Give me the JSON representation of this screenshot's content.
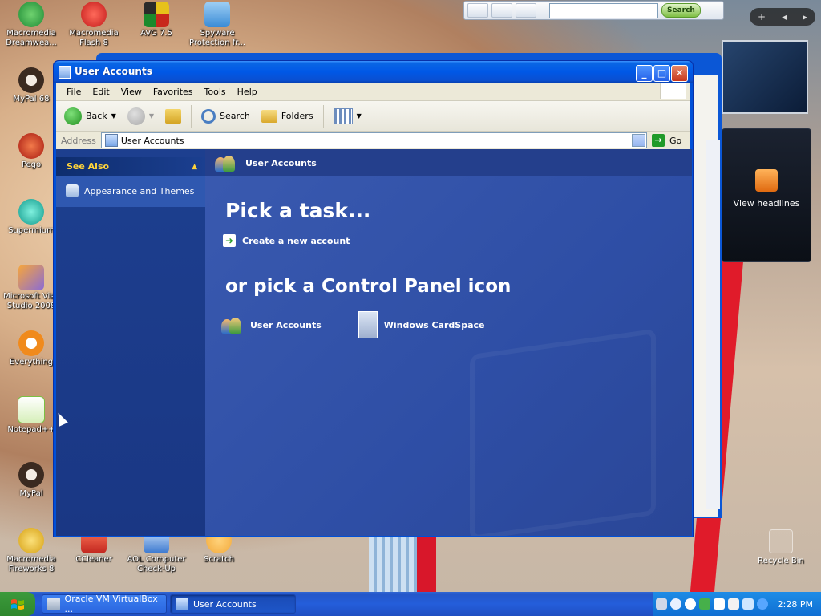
{
  "desktop": {
    "icons": [
      {
        "label": "Macromedia Dreamwea...",
        "icon": "dreamweaver-icon",
        "color": "#2aa84a"
      },
      {
        "label": "Macromedia Flash 8",
        "icon": "flash-icon",
        "color": "#d32222"
      },
      {
        "label": "AVG 7.5",
        "icon": "avg-icon",
        "color": "#e7c21a"
      },
      {
        "label": "Spyware Protection fr...",
        "icon": "spyware-icon",
        "color": "#4aa0e0"
      },
      {
        "label": "MyPal 68",
        "icon": "mypal-icon",
        "color": "#3b2a20"
      },
      {
        "label": "Pego",
        "icon": "pego-icon",
        "color": "#c2261f"
      },
      {
        "label": "Supermium",
        "icon": "supermium-icon",
        "color": "#1bb5a5"
      },
      {
        "label": "Microsoft Visu Studio 2008",
        "icon": "visual-studio-icon",
        "color": "#8a6bd6"
      },
      {
        "label": "Everything",
        "icon": "everything-icon",
        "color": "#f08a1c"
      },
      {
        "label": "Notepad++",
        "icon": "notepadpp-icon",
        "color": "#7bc043"
      },
      {
        "label": "MyPal",
        "icon": "mypal-icon",
        "color": "#3b2a20"
      },
      {
        "label": "Macromedia Fireworks 8",
        "icon": "fireworks-icon",
        "color": "#e8b21c"
      },
      {
        "label": "CCleaner",
        "icon": "ccleaner-icon",
        "color": "#d6452b"
      },
      {
        "label": "AOL Computer Check-Up",
        "icon": "aol-icon",
        "color": "#3a78d0"
      },
      {
        "label": "Scratch",
        "icon": "scratch-icon",
        "color": "#f2a93b"
      }
    ],
    "recycle_bin": "Recycle Bin"
  },
  "toolbar_top": {
    "search_button": "Search",
    "search_placeholder": ""
  },
  "gadget": {
    "headlines_label": "View headlines"
  },
  "window": {
    "title": "User Accounts",
    "menu": [
      "File",
      "Edit",
      "View",
      "Favorites",
      "Tools",
      "Help"
    ],
    "nav": {
      "back": "Back",
      "search": "Search",
      "folders": "Folders"
    },
    "address_label": "Address",
    "address_value": "User Accounts",
    "go_label": "Go",
    "see_also": {
      "title": "See Also",
      "item": "Appearance and Themes"
    },
    "header": "User Accounts",
    "pick_task": "Pick a task...",
    "task_create": "Create a new account",
    "or_pick": "or pick a Control Panel icon",
    "icons": [
      {
        "label": "User Accounts",
        "icon": "user-accounts-icon"
      },
      {
        "label": "Windows CardSpace",
        "icon": "cardspace-icon"
      }
    ]
  },
  "taskbar": {
    "start_icon": "windows-flag-icon",
    "buttons": [
      {
        "label": "Oracle VM VirtualBox ..."
      },
      {
        "label": "User Accounts"
      }
    ],
    "clock": "2:28 PM"
  },
  "colors": {
    "xp_blue": "#0058e6",
    "task_green": "#2a9d2a",
    "see_also_gold": "#ffd43a"
  }
}
